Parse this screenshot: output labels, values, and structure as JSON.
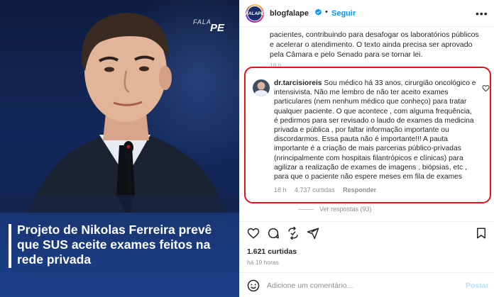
{
  "post_image": {
    "brand_logo_small": "FALA",
    "brand_logo_large": "PE",
    "headline": "Projeto de Nikolas Ferreira prevê que SUS aceite exames feitos na rede privada"
  },
  "header": {
    "avatar_text": "FALAPE",
    "username": "blogfalape",
    "separator": "•",
    "follow_label": "Seguir",
    "more_icon": "more-horizontal-icon"
  },
  "caption": {
    "text": "pacientes, contribuindo para desafogar os laboratórios públicos e acelerar o atendimento. O texto ainda precisa ser aprovado pela Câmara e pelo Senado para se tornar lei.",
    "time": "18 h"
  },
  "highlighted_comment": {
    "username": "dr.tarcisioreis",
    "text": "Sou médico há 33 anos, cirurgião oncológico e intensivista. Não me lembro de não ter aceito exames particulares (nem nenhum médico que conheço) para tratar qualquer paciente. O que acontece , com alguma frequência, é pedirmos para ser revisado o laudo de exames da medicina privada e pública , por faltar informação importante ou discordarmos. Essa pauta não é importante!!! A pauta importante é a criação de mais parcerias público-privadas (nrincipalmente com hospitais filantrópicos e clínicas) para agilizar a realização de exames de imagens , biópsias, etc , para que o paciente não espere meses em fila de exames",
    "time": "18 h",
    "likes": "4.737 curtidas",
    "reply_label": "Responder",
    "highlight_color": "#e0141c"
  },
  "view_replies": "Ver respostas (93)",
  "likes_count": "1.621 curtidas",
  "post_time": "há 19 horas",
  "comment_bar": {
    "placeholder": "Adicione um comentário...",
    "post_label": "Postar"
  },
  "colors": {
    "accent": "#0095f6",
    "post_disabled": "#b2dffc",
    "headline_bg": "#1c408c"
  }
}
